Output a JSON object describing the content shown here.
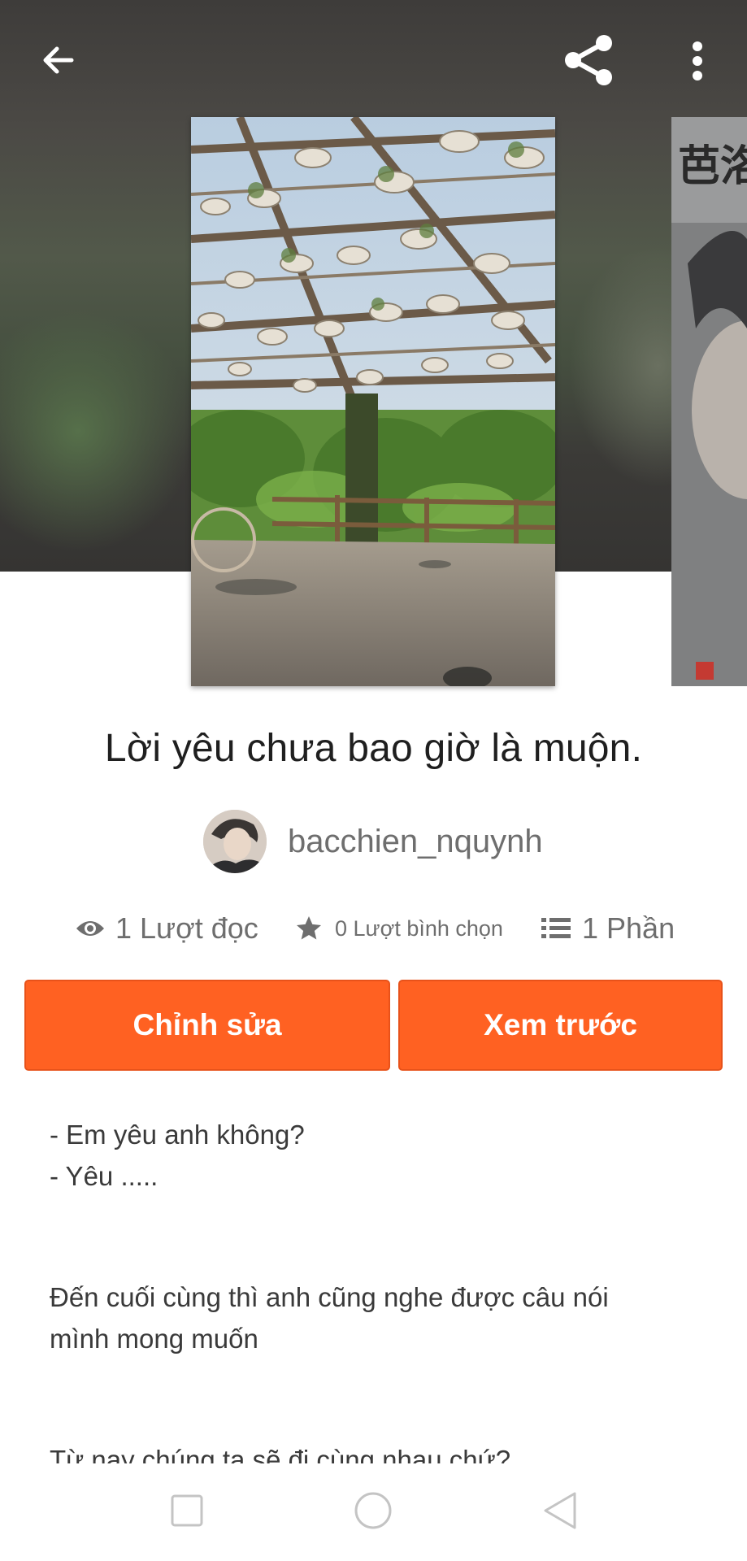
{
  "story": {
    "title": "Lời yêu chưa bao giờ là muộn.",
    "author": "bacchien_nquynh"
  },
  "icons": {
    "back": "arrow-left-icon",
    "share": "share-icon",
    "more": "more-vertical-icon",
    "reads": "eye-icon",
    "votes": "star-icon",
    "parts": "list-icon"
  },
  "stats": {
    "reads_label": "1 Lượt đọc",
    "votes_label": "0 Lượt bình chọn",
    "parts_label": "1 Phần"
  },
  "actions": {
    "edit_label": "Chỉnh sửa",
    "preview_label": "Xem trước"
  },
  "excerpt": {
    "line1": "- Em yêu anh không?",
    "line2": "- Yêu .....",
    "paragraph2": "Đến cuối cùng thì anh cũng nghe được câu nói mình mong muốn",
    "paragraph3": "Từ nay chúng ta sẽ đi cùng nhau chứ?"
  },
  "next_cover_text": "芭洛",
  "colors": {
    "accent": "#ff6122",
    "text_primary": "#1f1f1f",
    "text_secondary": "#6e6e6e"
  }
}
